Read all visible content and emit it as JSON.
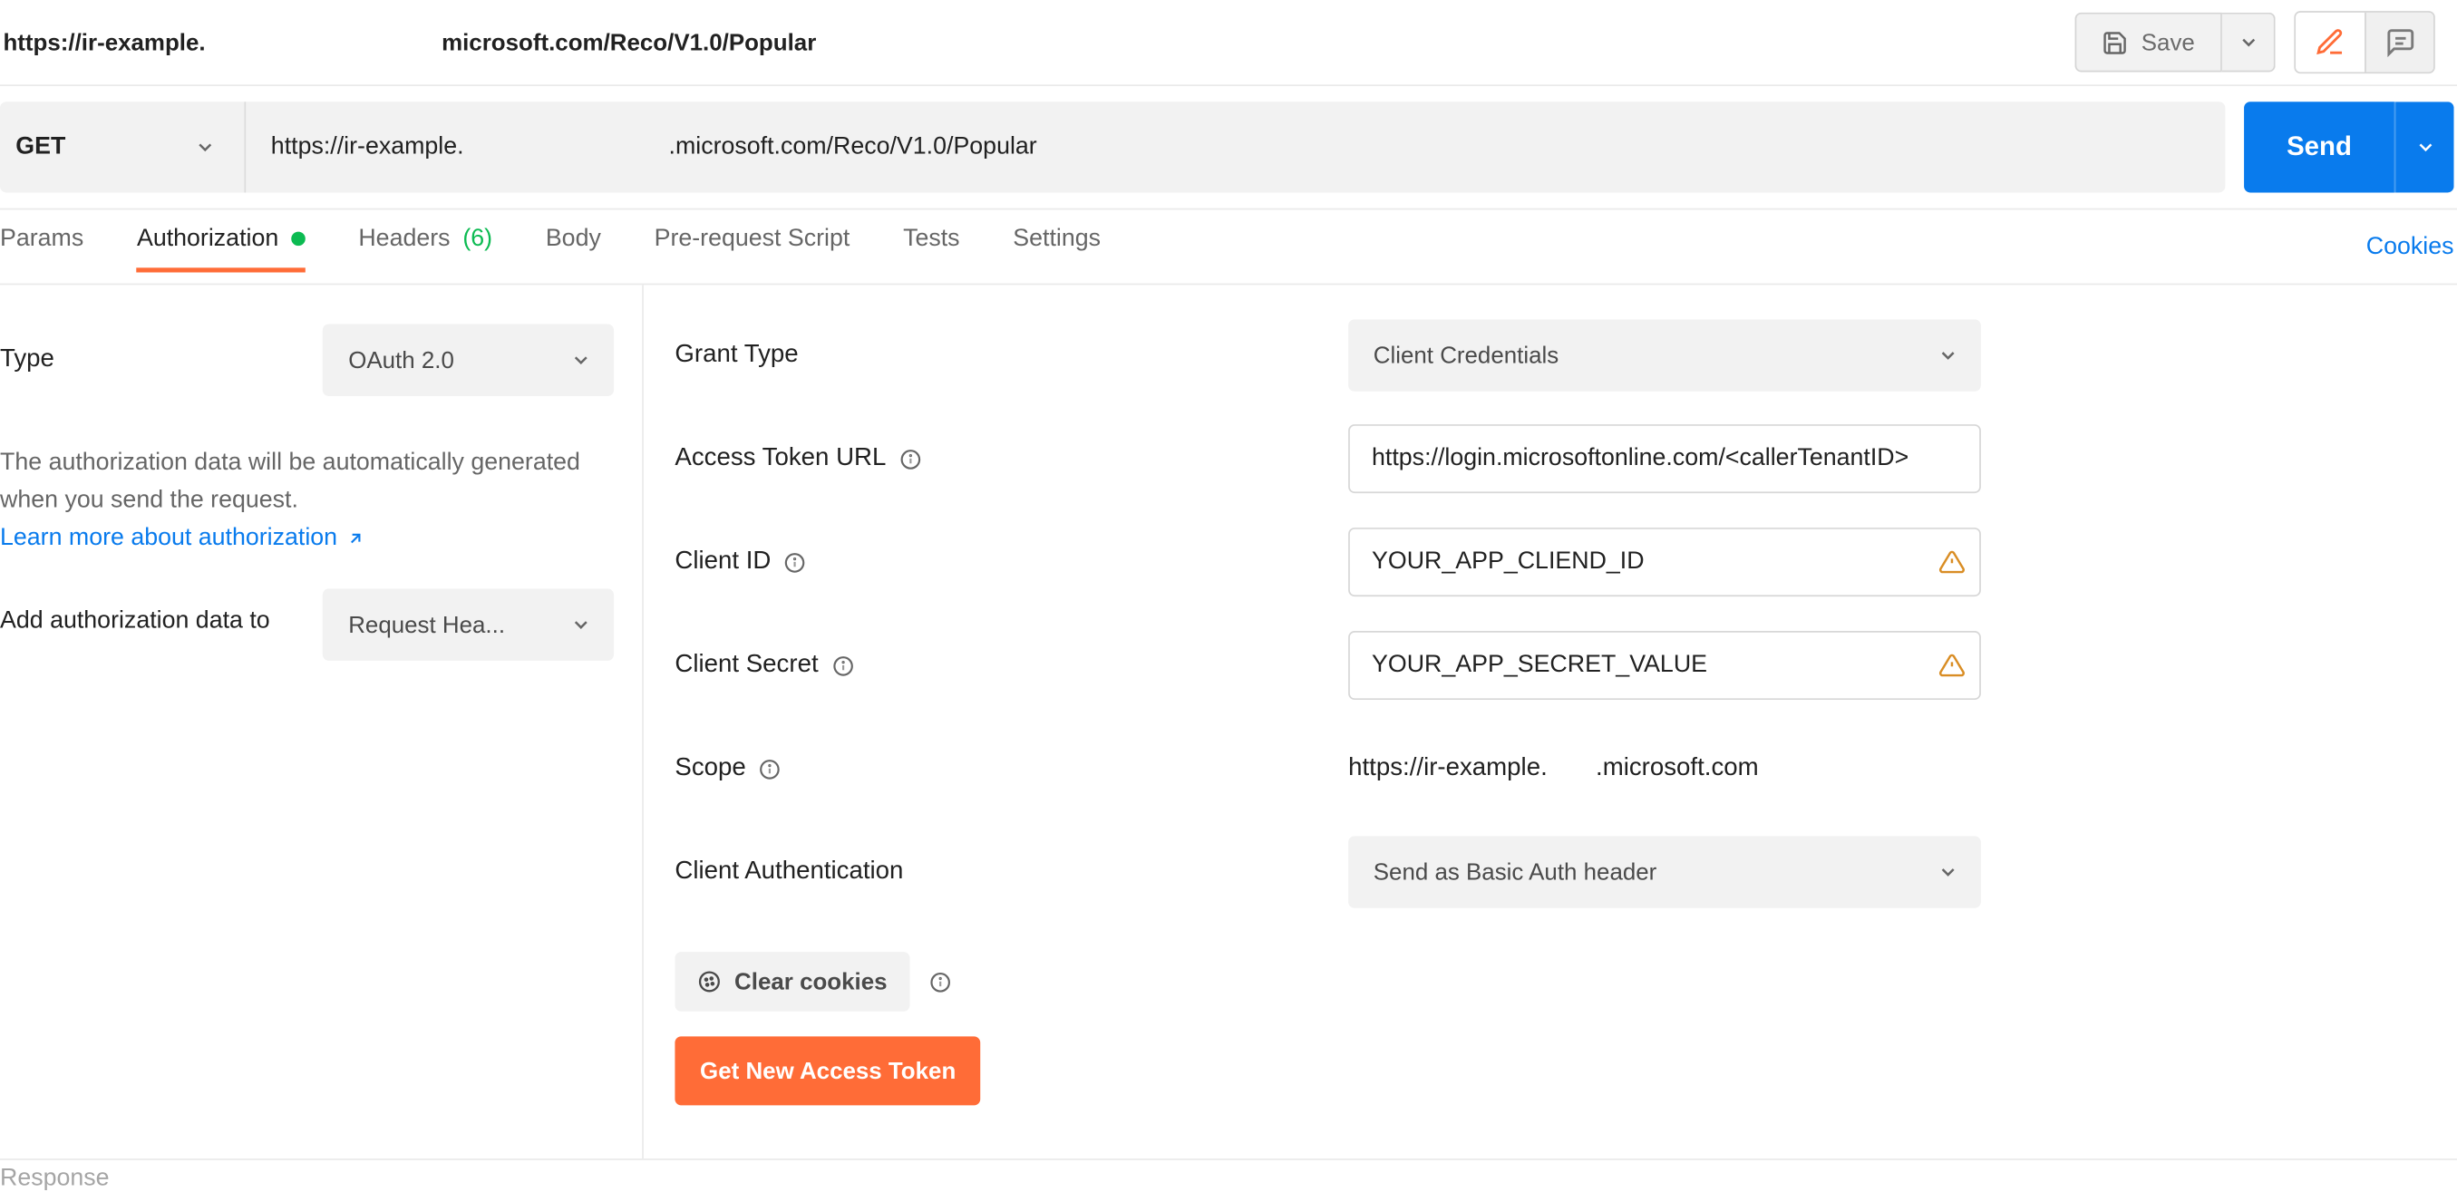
{
  "topbar": {
    "title_a": "https://ir-example.",
    "title_b": "microsoft.com/Reco/V1.0/Popular",
    "save_label": "Save"
  },
  "request": {
    "method": "GET",
    "url_a": "https://ir-example.",
    "url_b": ".microsoft.com/Reco/V1.0/Popular",
    "send_label": "Send"
  },
  "tabs": {
    "params": "Params",
    "authorization": "Authorization",
    "headers": "Headers",
    "headers_count": "(6)",
    "body": "Body",
    "prerequest": "Pre-request Script",
    "tests": "Tests",
    "settings": "Settings",
    "cookies": "Cookies"
  },
  "left": {
    "type_label": "Type",
    "type_value": "OAuth 2.0",
    "copy": "The authorization data will be automatically generated when you send the request.",
    "learn_more": "Learn more about authorization",
    "addto_label": "Add authorization data to",
    "addto_value": "Request Hea..."
  },
  "form": {
    "grant_type_label": "Grant Type",
    "grant_type_value": "Client Credentials",
    "access_token_url_label": "Access Token URL",
    "access_token_url_value": "https://login.microsoftonline.com/<callerTenantID>",
    "client_id_label": "Client ID",
    "client_id_value": "YOUR_APP_CLIEND_ID",
    "client_secret_label": "Client Secret",
    "client_secret_value": "YOUR_APP_SECRET_VALUE",
    "scope_label": "Scope",
    "scope_value_a": "https://ir-example.",
    "scope_value_b": ".microsoft.com",
    "client_auth_label": "Client Authentication",
    "client_auth_value": "Send as Basic Auth header",
    "clear_cookies": "Clear cookies",
    "get_token": "Get New Access Token"
  },
  "footer": {
    "response": "Response"
  }
}
